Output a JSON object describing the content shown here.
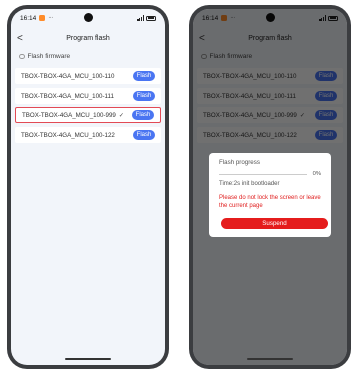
{
  "status_bar": {
    "time": "16:14",
    "dots": "···",
    "network": "5G",
    "battery": "78"
  },
  "header": {
    "title": "Program flash",
    "back": "<"
  },
  "section": {
    "title": "Flash firmware"
  },
  "firmware_items": [
    {
      "name": "TBOX-TBOX-4GA_MCU_100-110",
      "button": "Flash",
      "selected": false
    },
    {
      "name": "TBOX-TBOX-4GA_MCU_100-111",
      "button": "Flash",
      "selected": false
    },
    {
      "name": "TBOX-TBOX-4GA_MCU_100-999",
      "button": "Flash",
      "selected": true
    },
    {
      "name": "TBOX-TBOX-4GA_MCU_100-122",
      "button": "Flash",
      "selected": false
    }
  ],
  "selected_mark": "✓",
  "dialog": {
    "title": "Flash progress",
    "progress_text": "0%",
    "progress_value": 0,
    "time_text": "Time:2s init bootloader",
    "warning": "Please do not lock the screen or leave the current page",
    "suspend_label": "Suspend"
  },
  "colors": {
    "accent": "#4a75f2",
    "danger": "#e51c1c",
    "selected_border": "#e24a55"
  },
  "icons": [
    "back-arrow-icon",
    "info-icon",
    "check-icon",
    "camera-icon",
    "signal-icon",
    "battery-icon"
  ]
}
